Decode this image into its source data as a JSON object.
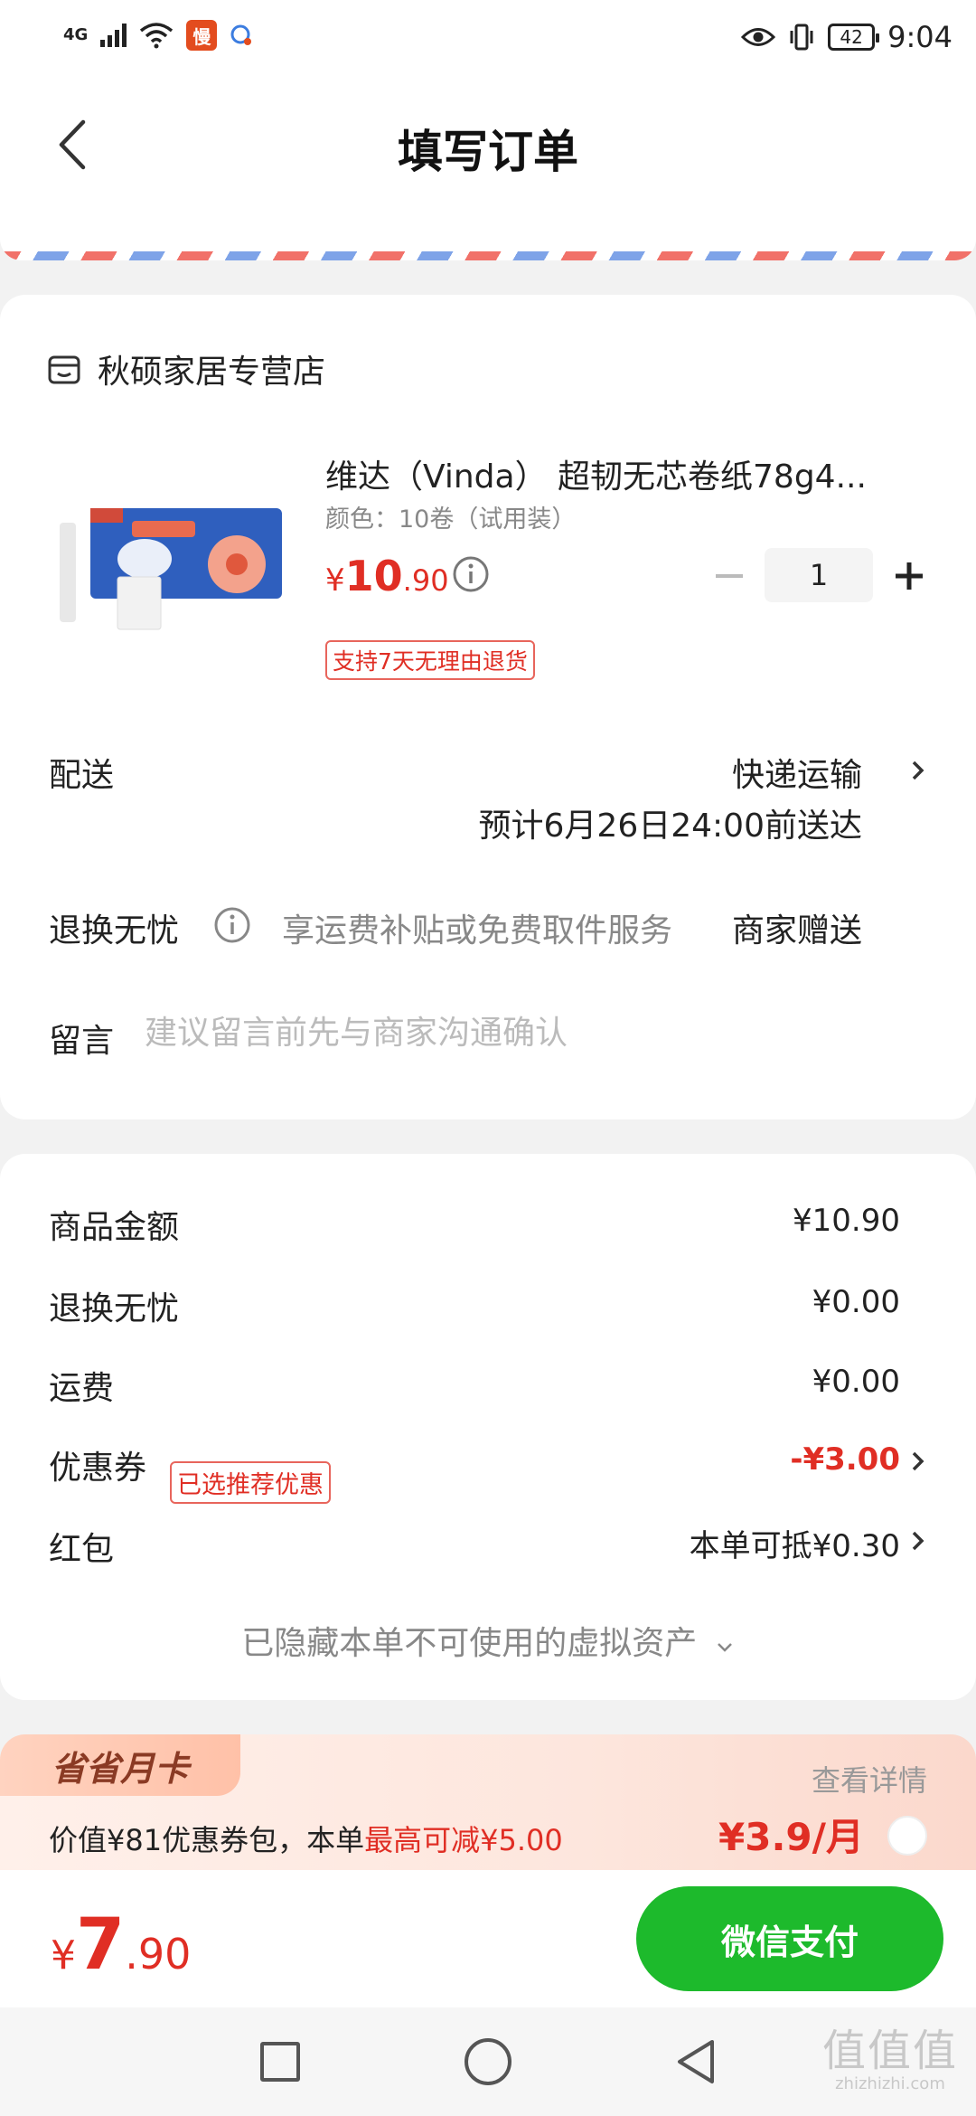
{
  "status_bar": {
    "network": "4G",
    "app_badge": "慢",
    "battery": "42",
    "time": "9:04"
  },
  "header": {
    "title": "填写订单"
  },
  "store": {
    "name": "秋硕家居专营店"
  },
  "product": {
    "title": "维达（Vinda） 超韧无芯卷纸78g4...",
    "spec": "颜色：10卷（试用装）",
    "price_currency": "¥",
    "price_int": "10",
    "price_dec": ".90",
    "quantity": "1",
    "return_policy": "支持7天无理由退货"
  },
  "delivery": {
    "label": "配送",
    "method": "快递运输",
    "eta": "预计6月26日24:00前送达"
  },
  "exchange": {
    "label": "退换无忧",
    "desc": "享运费补贴或免费取件服务",
    "gift": "商家赠送"
  },
  "message": {
    "label": "留言",
    "placeholder": "建议留言前先与商家沟通确认"
  },
  "summary": {
    "goods_label": "商品金额",
    "goods_value": "¥10.90",
    "exchange_label": "退换无忧",
    "exchange_value": "¥0.00",
    "shipping_label": "运费",
    "shipping_value": "¥0.00",
    "coupon_label": "优惠券",
    "coupon_tag": "已选推荐优惠",
    "coupon_value": "-¥3.00",
    "redpacket_label": "红包",
    "redpacket_value": "本单可抵¥0.30",
    "hidden_assets": "已隐藏本单不可使用的虚拟资产"
  },
  "promo": {
    "badge": "省省月卡",
    "detail_link": "查看详情",
    "desc_prefix": "价值¥81优惠券包，本单",
    "desc_highlight": "最高可减¥5.00",
    "price": "¥3.9/月"
  },
  "paybar": {
    "total_currency": "¥",
    "total_int": "7",
    "total_dec": ".90",
    "pay_label": "微信支付"
  },
  "watermark": {
    "glyph": "值值值",
    "url": "zhizhizhi.com"
  },
  "colors": {
    "accent_red": "#e02e24",
    "pay_green": "#1dba2c"
  }
}
